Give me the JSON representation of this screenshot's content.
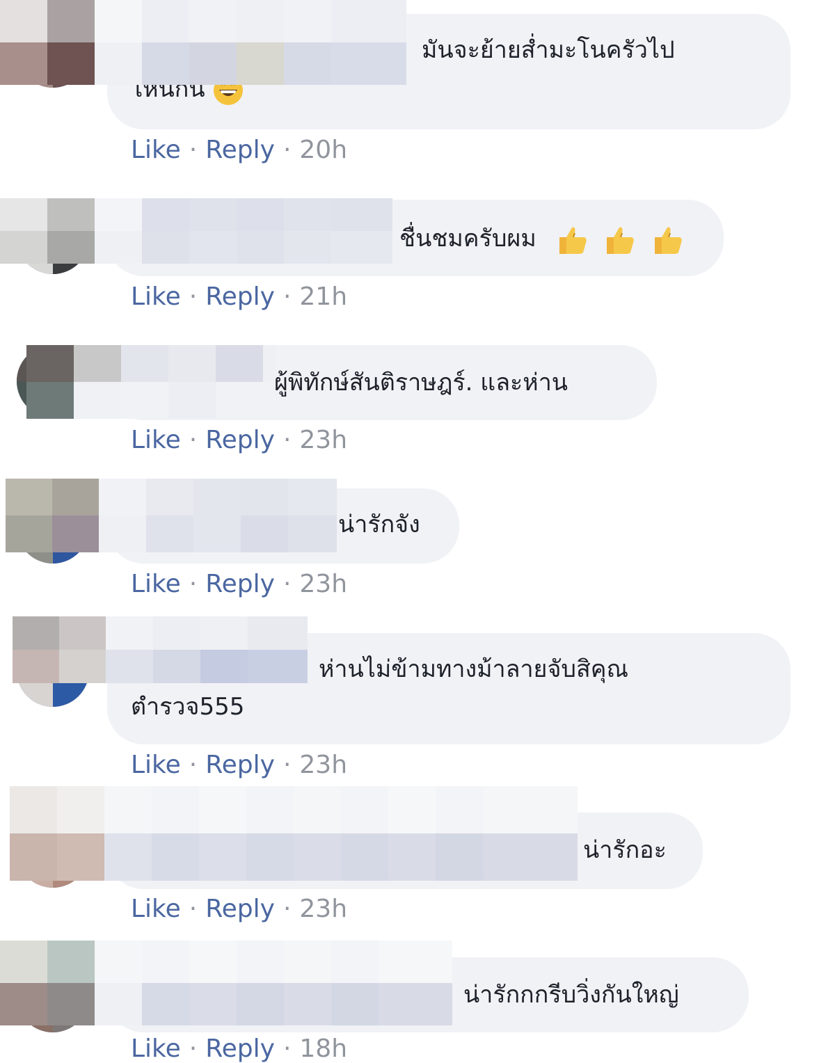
{
  "actions": {
    "like_label": "Like",
    "reply_label": "Reply",
    "separator": "·"
  },
  "comments": [
    {
      "text_line1": "มันจะย้ายส่ำมะโนครัวไป",
      "text_line2": "ไหนกัน",
      "emoji": "grinning-face-icon",
      "time": "20h"
    },
    {
      "text_line1": "ชื่นชมครับผม",
      "emoji": "thumbs-up-icon x3",
      "time": "21h"
    },
    {
      "text_line1": "ผู้พิทักษ์สันติราษฎร์. และห่าน",
      "time": "23h"
    },
    {
      "text_line1": "น่ารักจัง",
      "time": "23h"
    },
    {
      "text_line1": "ห่านไม่ข้ามทางม้าลายจับสิคุณ",
      "text_line2": "ตำรวจ555",
      "time": "23h"
    },
    {
      "text_line1": "น่ารักอะ",
      "time": "23h"
    },
    {
      "text_line1": "น่ารักกกรีบวิ่งกันใหญ่",
      "time": "18h"
    }
  ],
  "colors": {
    "link": "#4b67a1",
    "meta": "#90949c",
    "bubble": "#f1f2f6",
    "text": "#1d2129"
  }
}
